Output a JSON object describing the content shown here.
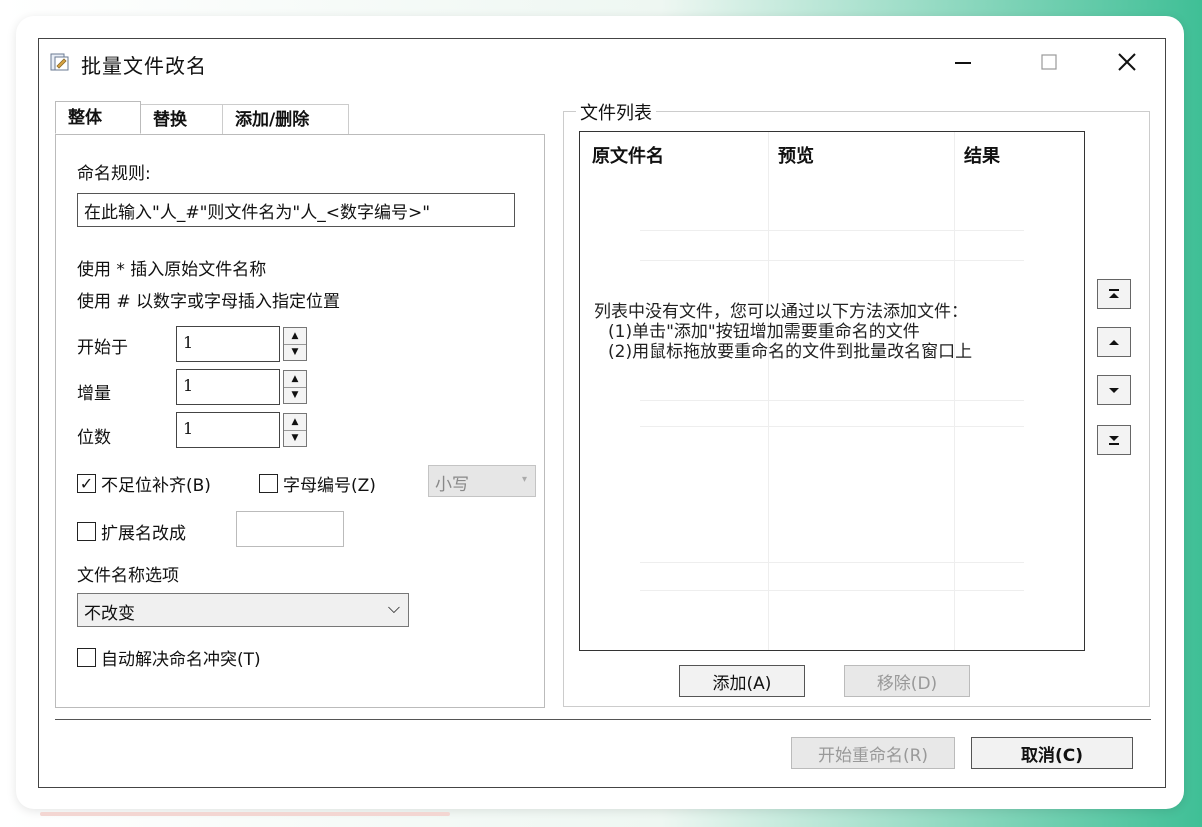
{
  "window": {
    "title": "批量文件改名",
    "controls": {
      "minimize": "—",
      "maximize": "☐",
      "close": "✕"
    }
  },
  "tabs": [
    {
      "label": "整体",
      "selected": true
    },
    {
      "label": "替换",
      "selected": false
    },
    {
      "label": "添加/删除",
      "selected": false
    }
  ],
  "overall": {
    "naming_rule_label": "命名规则:",
    "naming_rule_value": "在此输入\"人_#\"则文件名为\"人_<数字编号>\"",
    "hint_1": "使用 * 插入原始文件名称",
    "hint_2": "使用 # 以数字或字母插入指定位置",
    "start_label": "开始于",
    "start_value": "1",
    "step_label": "增量",
    "step_value": "1",
    "digits_label": "位数",
    "digits_value": "1",
    "pad_checkbox_label": "不足位补齐(B)",
    "pad_checked": true,
    "letter_checkbox_label": "字母编号(Z)",
    "letter_checked": false,
    "case_combo_value": "小写",
    "ext_checkbox_label": "扩展名改成",
    "ext_checked": false,
    "ext_value": "",
    "filename_options_label": "文件名称选项",
    "filename_option_value": "不改变",
    "autoresolve_label": "自动解决命名冲突(T)",
    "autoresolve_checked": false
  },
  "file_list": {
    "group_title": "文件列表",
    "columns": [
      "原文件名",
      "预览",
      "结果"
    ],
    "empty_message": [
      "列表中没有文件，您可以通过以下方法添加文件：",
      "(1)单击\"添加\"按钮增加需要重命名的文件",
      "(2)用鼠标拖放要重命名的文件到批量改名窗口上"
    ],
    "add_button": "添加(A)",
    "remove_button": "移除(D)"
  },
  "footer": {
    "start_button": "开始重命名(R)",
    "cancel_button": "取消(C)"
  }
}
